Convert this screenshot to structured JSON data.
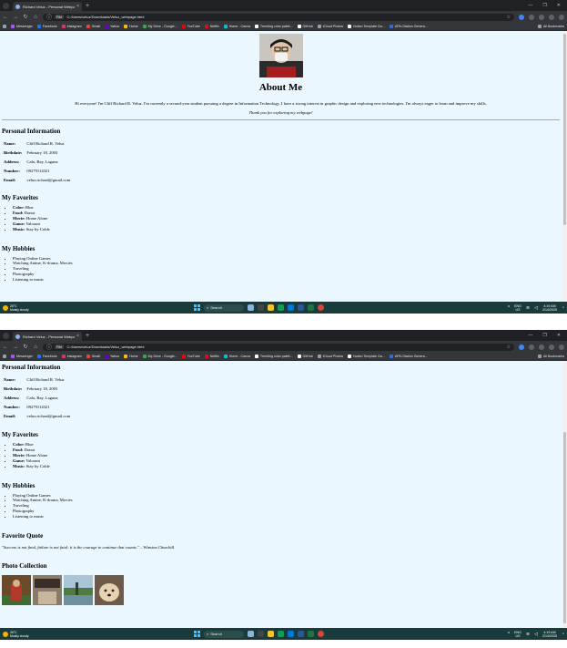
{
  "browser": {
    "tab_title": "Richard Veluz - Personal Webpa",
    "tab_close": "×",
    "new_tab": "+",
    "omnibox_chip": "File",
    "url": "C:/Users/veluz/Downloads/Veluz_webpage.html",
    "bookmarks": [
      "Messenger",
      "Facebook",
      "Instagram",
      "Gmail",
      "Yahoo",
      "Home",
      "My Drive - Google...",
      "YouTube",
      "Netflix",
      "Home - Canva",
      "Trending color palett...",
      "GitHub",
      "iCloud Photos",
      "Notion Template Ga...",
      "APA Citation Genera..."
    ],
    "all_bookmarks": "All Bookmarks",
    "window_controls": [
      "—",
      "❐",
      "✕"
    ]
  },
  "page": {
    "about_title": "About Me",
    "intro": "Hi everyone! I'm Cliff Richard R. Veluz. I'm currently a second-year student pursuing a degree in Information Technology. I have a strong interest in graphic design and exploring new technologies. I'm always eager to learn and improve my skills.",
    "thanks": "Thank you for exploring my webpage!",
    "personal_info_heading": "Personal Information",
    "personal_info": [
      {
        "key": "Name:",
        "value": "Cliff Richard R. Veluz"
      },
      {
        "key": "Birthdate:",
        "value": "February 18, 2003"
      },
      {
        "key": "Address:",
        "value": "Calo, Bay, Laguna"
      },
      {
        "key": "Number:",
        "value": "09279114321"
      },
      {
        "key": "Email:",
        "value": "veluz.richard@gmail.com"
      }
    ],
    "favorites_heading": "My Favorites",
    "favorites": [
      {
        "key": "Color:",
        "value": " Blue"
      },
      {
        "key": "Food:",
        "value": " Donut"
      },
      {
        "key": "Movie:",
        "value": " Home Alone"
      },
      {
        "key": "Game:",
        "value": " Valorant"
      },
      {
        "key": "Music:",
        "value": " Stay by Colde"
      }
    ],
    "hobbies_heading": "My Hobbies",
    "hobbies": [
      "Playing Online Games",
      "Watching Anime, K-drama, Movies",
      "Traveling",
      "Photography",
      "Listening to music"
    ],
    "quote_heading": "Favorite Quote",
    "quote_text": "\"Success is not final, failure is not fatal: it is the courage to continue that counts.\"",
    "quote_author": " – Winston Churchill",
    "photo_heading": "Photo Collection"
  },
  "taskbar": {
    "weather_temp": "26°C",
    "weather_desc": "Mostly cloudy",
    "search_label": "Search",
    "lang": "ENG",
    "lang_sub": "US",
    "time": "4:19 AM",
    "date": "2/14/2025"
  },
  "colors": {
    "page_bg": "#eaf7ff",
    "chrome_dark": "#35363a",
    "taskbar": "#1a3b3b"
  }
}
